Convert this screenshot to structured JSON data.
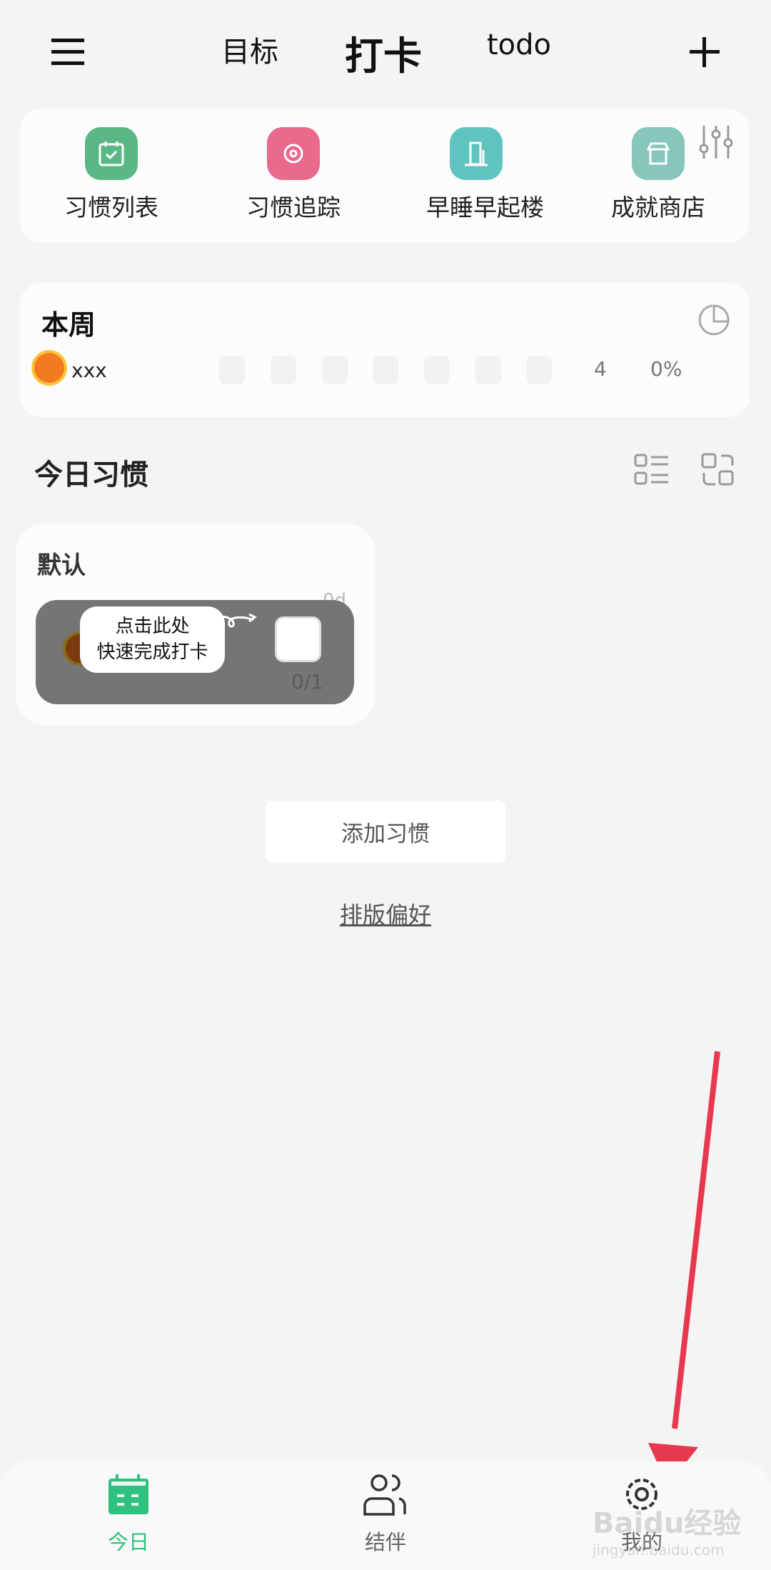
{
  "header": {
    "tabs": [
      {
        "label": "目标"
      },
      {
        "label": "打卡",
        "active": true
      },
      {
        "label": "todo"
      }
    ],
    "menu_icon": "hamburger-icon",
    "add_icon": "plus-icon"
  },
  "shortcuts": [
    {
      "label": "习惯列表",
      "icon": "calendar-check-icon",
      "color": "#5ab887"
    },
    {
      "label": "习惯追踪",
      "icon": "target-icon",
      "color": "#ea6a8e"
    },
    {
      "label": "早睡早起楼",
      "icon": "building-icon",
      "color": "#5fc4bf"
    },
    {
      "label": "成就商店",
      "icon": "store-icon",
      "color": "#86c6bb"
    }
  ],
  "week": {
    "title": "本周",
    "habit": {
      "name": "xxx",
      "icon": "sun-icon",
      "count": "4",
      "rate": "0%"
    }
  },
  "today": {
    "title": "今日习惯",
    "group": "默认",
    "streak": "0d",
    "progress": "0/1",
    "tooltip_line1": "点击此处",
    "tooltip_line2": "快速完成打卡"
  },
  "add_habit": "添加习惯",
  "layout_pref": "排版偏好",
  "nav": [
    {
      "label": "今日",
      "active": true,
      "icon": "calendar-icon"
    },
    {
      "label": "结伴",
      "icon": "users-icon"
    },
    {
      "label": "我的",
      "icon": "gear-icon"
    }
  ],
  "watermark": {
    "text": "Baidu经验",
    "url": "jingyan.baidu.com"
  },
  "colors": {
    "accent": "#2ec27e",
    "arrow": "#e8384f"
  }
}
